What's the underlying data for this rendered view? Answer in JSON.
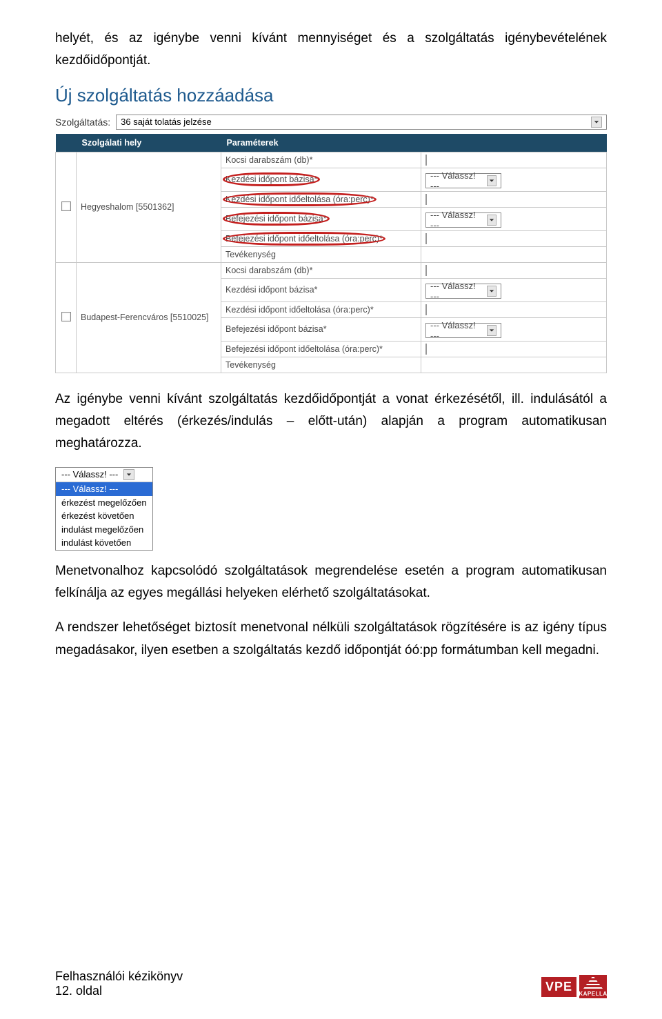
{
  "para1": "helyét, és az igénybe venni kívánt mennyiséget és a szolgáltatás igénybevételének kezdőidőpontját.",
  "section_title": "Új szolgáltatás hozzáadása",
  "form": {
    "szolg_label": "Szolgáltatás:",
    "szolg_value": "36 saját tolatás jelzése"
  },
  "table": {
    "head_loc": "Szolgálati hely",
    "head_param": "Paraméterek",
    "loc1": "Hegyeshalom [5501362]",
    "loc2": "Budapest-Ferencváros [5510025]",
    "rows": {
      "r1": "Kocsi darabszám (db)*",
      "r2": "Kezdési időpont bázisa*",
      "r3": "Kezdési időpont időeltolása (óra:perc)*",
      "r4": "Befejezési időpont bázisa*",
      "r5": "Befejezési időpont időeltolása (óra:perc)*",
      "r6": "Tevékenység"
    },
    "valassz": "--- Válassz! ---"
  },
  "para2": "Az igénybe venni kívánt szolgáltatás kezdőidőpontját a vonat érkezésétől, ill. indulásától a megadott eltérés (érkezés/indulás – előtt-után) alapján a program automatikusan meghatározza.",
  "dropdown": {
    "top": "--- Válassz! ---",
    "sel": "--- Válassz! ---",
    "o1": "érkezést megelőzően",
    "o2": "érkezést követően",
    "o3": "indulást megelőzően",
    "o4": "indulást követően"
  },
  "para3": "Menetvonalhoz kapcsolódó szolgáltatások megrendelése esetén a program automatikusan felkínálja az egyes megállási helyeken elérhető szolgáltatásokat.",
  "para4": "A rendszer lehetőséget biztosít menetvonal nélküli szolgáltatások rögzítésére is az igény típus megadásakor, ilyen esetben a szolgáltatás kezdő időpontját óó:pp formátumban kell megadni.",
  "footer": {
    "title": "Felhasználói kézikönyv",
    "page": "12. oldal",
    "logo_vpe": "VPE",
    "logo_kapella": "KAPELLA"
  }
}
